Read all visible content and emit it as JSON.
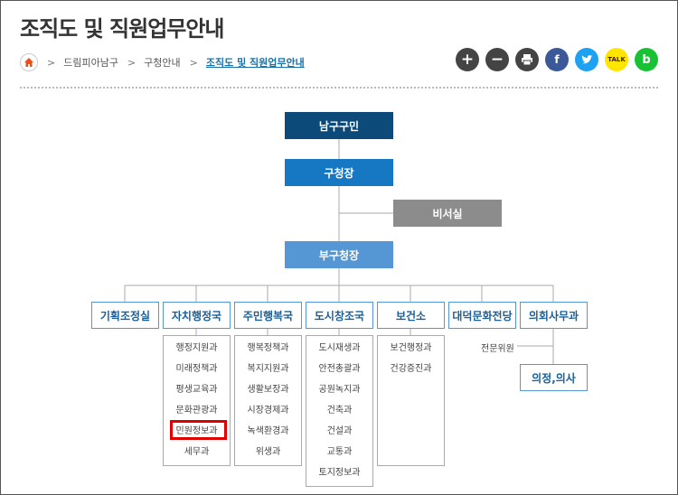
{
  "page": {
    "title": "조직도 및 직원업무안내"
  },
  "breadcrumb": {
    "items": [
      "드림피아남구",
      "구청안내",
      "조직도 및 직원업무안내"
    ]
  },
  "share": {
    "plus": "+",
    "minus": "−",
    "print": "print",
    "facebook": "f",
    "twitter": "t",
    "kakaotalk": "TALK",
    "band": "b"
  },
  "org": {
    "top": "남구구민",
    "mayor": "구청장",
    "secretary": "비서실",
    "deputy": "부구청장",
    "departments": [
      {
        "name": "기획조정실",
        "subs": []
      },
      {
        "name": "자치행정국",
        "subs": [
          "행정지원과",
          "미래정책과",
          "평생교육과",
          "문화관광과",
          "민원정보과",
          "세무과"
        ]
      },
      {
        "name": "주민행복국",
        "subs": [
          "행복정책과",
          "복지지원과",
          "생활보장과",
          "시장경제과",
          "녹색환경과",
          "위생과"
        ]
      },
      {
        "name": "도시창조국",
        "subs": [
          "도시재생과",
          "안전총괄과",
          "공원녹지과",
          "건축과",
          "건설과",
          "교통과",
          "토지정보과"
        ]
      },
      {
        "name": "보건소",
        "subs": [
          "보건행정과",
          "건강증진과"
        ]
      },
      {
        "name": "대덕문화전당",
        "subs": []
      },
      {
        "name": "의회사무과",
        "subs": []
      }
    ],
    "council_staff": "전문위원",
    "council": "의정,의사"
  }
}
